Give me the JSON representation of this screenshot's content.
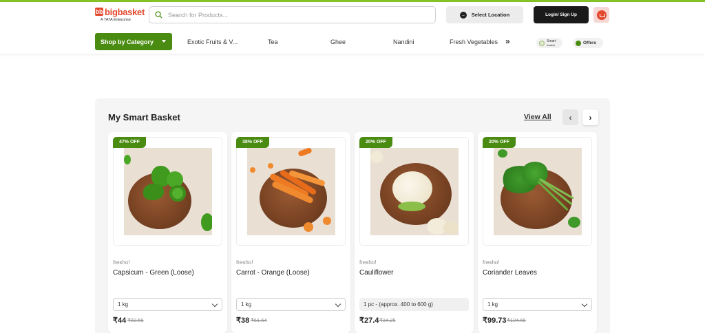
{
  "header": {
    "logo_text": "bigbasket",
    "logo_mark": "bb",
    "logo_sub": "A TATA Enterprise",
    "search_placeholder": "Search for Products...",
    "location_label": "Select Location",
    "login_label": "Login/ Sign Up",
    "category_button": "Shop by Category",
    "nav_items": [
      {
        "label": "Exotic Fruits & V..."
      },
      {
        "label": "Tea"
      },
      {
        "label": "Ghee"
      },
      {
        "label": "Nandini"
      },
      {
        "label": "Fresh Vegetables"
      }
    ],
    "more_label": "»",
    "smart_label_1": "Smart",
    "smart_label_2": "basket",
    "offers_label": "Offers",
    "icons": [
      "search-icon",
      "location-icon",
      "cart-icon",
      "chevron-down-icon"
    ],
    "colors": {
      "accent": "#84c225",
      "brand_red": "#e3482d",
      "green": "#4a8c12"
    }
  },
  "section": {
    "title": "My Smart Basket",
    "view_all": "View All",
    "prev_arrow": "‹",
    "next_arrow": "›"
  },
  "products": [
    {
      "badge": "47% OFF",
      "brand": "fresho!",
      "name": "Capsicum - Green (Loose)",
      "qty": "1 kg",
      "price": "₹44",
      "mrp": "₹83.56"
    },
    {
      "badge": "38% OFF",
      "brand": "fresho!",
      "name": "Carrot - Orange (Loose)",
      "qty": "1 kg",
      "price": "₹38",
      "mrp": "₹61.64"
    },
    {
      "badge": "20% OFF",
      "brand": "fresho!",
      "name": "Cauliflower",
      "qty": "1 pc - (approx. 400 to 600 g)",
      "price": "₹27.4",
      "mrp": "₹34.25"
    },
    {
      "badge": "20% OFF",
      "brand": "fresho!",
      "name": "Coriander Leaves",
      "qty": "1 kg",
      "price": "₹99.73",
      "mrp": "₹124.66"
    }
  ]
}
